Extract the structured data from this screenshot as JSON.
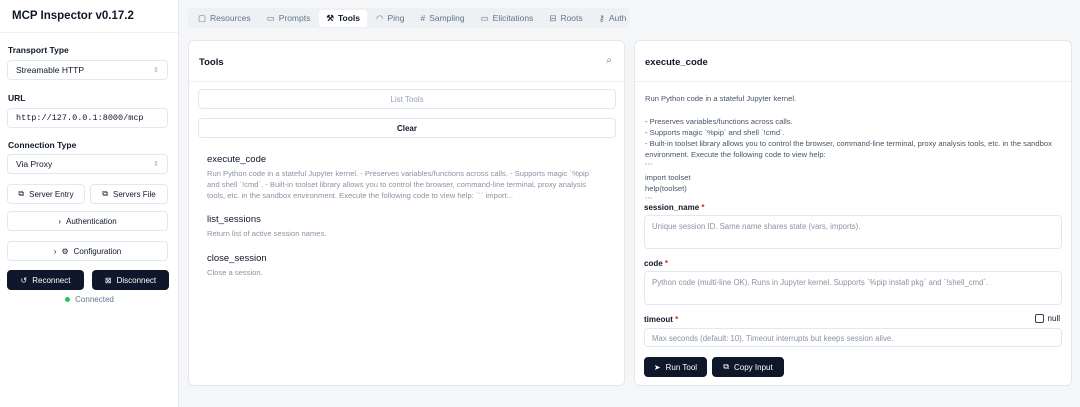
{
  "app": {
    "title": "MCP Inspector v0.17.2"
  },
  "sidebar": {
    "transport_label": "Transport Type",
    "transport_value": "Streamable HTTP",
    "url_label": "URL",
    "url_value": "http://127.0.0.1:8000/mcp",
    "connection_label": "Connection Type",
    "connection_value": "Via Proxy",
    "server_entry": "Server Entry",
    "servers_file": "Servers File",
    "authentication": "Authentication",
    "configuration": "Configuration",
    "reconnect": "Reconnect",
    "disconnect": "Disconnect",
    "status": "Connected",
    "status_color": "#22c55e"
  },
  "tabs": [
    {
      "label": "Resources"
    },
    {
      "label": "Prompts"
    },
    {
      "label": "Tools",
      "active": true
    },
    {
      "label": "Ping"
    },
    {
      "label": "Sampling"
    },
    {
      "label": "Elicitations"
    },
    {
      "label": "Roots"
    },
    {
      "label": "Auth"
    }
  ],
  "tools_panel": {
    "title": "Tools",
    "list_tools": "List Tools",
    "clear": "Clear",
    "tools": [
      {
        "name": "execute_code",
        "description": "Run Python code in a stateful Jupyter kernel. - Preserves variables/functions across calls. - Supports magic `%pip` and shell `!cmd`. - Built-in toolset library allows you to control the browser, command-line terminal, proxy analysis tools, etc. in the sandbox environment. Execute the following code to view help: ``` import..."
      },
      {
        "name": "list_sessions",
        "description": "Return list of active session names."
      },
      {
        "name": "close_session",
        "description": "Close a session."
      }
    ]
  },
  "detail": {
    "title": "execute_code",
    "description": "Run Python code in a stateful Jupyter kernel.\n\n- Preserves variables/functions across calls.\n- Supports magic `%pip` and shell `!cmd`.\n- Built-in toolset library allows you to control the browser, command-line terminal, proxy analysis tools, etc. in the sandbox environment. Execute the following code to view help:\n```\nimport toolset\nhelp(toolset)\n```",
    "fields": [
      {
        "name": "session_name",
        "required": "*",
        "placeholder": "Unique session ID. Same name shares state (vars, imports)."
      },
      {
        "name": "code",
        "required": "*",
        "placeholder": "Python code (multi-line OK). Runs in Jupyter kernel. Supports `%pip install pkg` and `!shell_cmd`."
      },
      {
        "name": "timeout",
        "required": "*",
        "placeholder": "Max seconds (default: 10). Timeout interrupts but keeps session alive.",
        "null_label": "null"
      }
    ],
    "run_tool": "Run Tool",
    "copy_input": "Copy Input"
  }
}
